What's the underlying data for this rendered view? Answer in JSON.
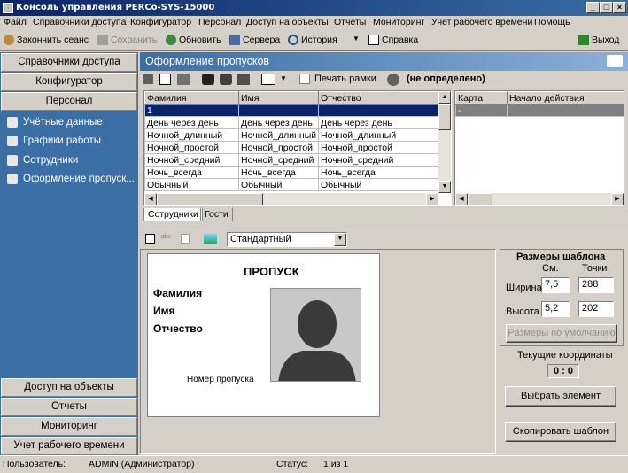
{
  "window": {
    "title": "Консоль управления PERCo-SYS-15000"
  },
  "menu": [
    "Файл",
    "Справочники доступа",
    "Конфигуратор",
    "Персонал",
    "Доступ на объекты",
    "Отчеты",
    "Мониторинг",
    "Учет рабочего времени",
    "Помощь"
  ],
  "toolbar": {
    "end_session": "Закончить сеанс",
    "save": "Сохранить",
    "refresh": "Обновить",
    "servers": "Сервера",
    "history": "История",
    "help": "Справка",
    "exit": "Выход"
  },
  "nav": {
    "top": [
      "Справочники доступа",
      "Конфигуратор",
      "Персонал"
    ],
    "items": [
      "Учётные данные",
      "Графики работы",
      "Сотрудники",
      "Оформление пропуск..."
    ],
    "bottom": [
      "Доступ на объекты",
      "Отчеты",
      "Мониторинг",
      "Учет рабочего времени"
    ]
  },
  "content": {
    "header": "Оформление пропусков",
    "print_frames": "Печать рамки",
    "undefined_label": "(не определено)",
    "grid": {
      "headers": [
        "Фамилия",
        "Имя",
        "Отчество"
      ],
      "rows": [
        [
          "1",
          "",
          ""
        ],
        [
          "День через день",
          "День через день",
          "День через день"
        ],
        [
          "Ночной_длинный",
          "Ночной_длинный",
          "Ночной_длинный"
        ],
        [
          "Ночной_простой",
          "Ночной_простой",
          "Ночной_простой"
        ],
        [
          "Ночной_средний",
          "Ночной_средний",
          "Ночной_средний"
        ],
        [
          "Ночь_всегда",
          "Ночь_всегда",
          "Ночь_всегда"
        ],
        [
          "Обычный",
          "Обычный",
          "Обычный"
        ]
      ]
    },
    "card_grid": {
      "headers": [
        "Карта",
        "Начало действия"
      ],
      "rows": [
        [
          "-",
          ""
        ]
      ]
    },
    "tabs": [
      "Сотрудники",
      "Гости"
    ],
    "template_select": "Стандартный",
    "pass": {
      "title": "ПРОПУСК",
      "surname": "Фамилия",
      "name": "Имя",
      "patronymic": "Отчество",
      "number": "Номер пропуска"
    },
    "sizes": {
      "title": "Размеры шаблона",
      "col_cm": "См.",
      "col_pt": "Точки",
      "width_label": "Ширина",
      "width_cm": "7,5",
      "width_pt": "288",
      "height_label": "Высота",
      "height_cm": "5,2",
      "height_pt": "202",
      "default_btn": "Размеры по умолчанию"
    },
    "coords": {
      "title": "Текущие координаты",
      "value": "0 : 0"
    },
    "select_element": "Выбрать элемент",
    "copy_template": "Скопировать шаблон"
  },
  "status": {
    "user_label": "Пользователь:",
    "user": "ADMIN (Администратор)",
    "status_label": "Статус:",
    "status": "1 из 1"
  }
}
